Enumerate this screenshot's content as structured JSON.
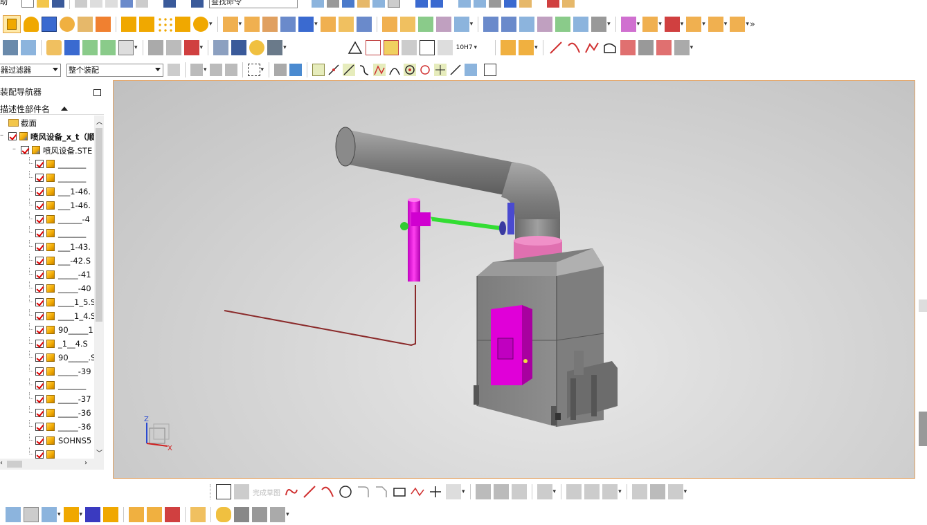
{
  "window": {
    "title_partial": "助"
  },
  "toolbar_top": {
    "command_finder_placeholder": "查找命令"
  },
  "selection_bar": {
    "filter_select": "器过滤器",
    "scope_select": "整个装配"
  },
  "navigator": {
    "title": "装配导航器",
    "column_header": "描述性部件名",
    "items": [
      {
        "label": "截面",
        "type": "folder",
        "indent": 0
      },
      {
        "label": "喷风设备_x_t（顺",
        "type": "assembly",
        "indent": 1,
        "bold": true
      },
      {
        "label": "喷风设备.STE",
        "type": "assembly",
        "indent": 2
      },
      {
        "label": "_______",
        "type": "part"
      },
      {
        "label": "_______",
        "type": "part"
      },
      {
        "label": "___1-46.",
        "type": "part"
      },
      {
        "label": "___1-46.",
        "type": "part"
      },
      {
        "label": "______-4",
        "type": "part"
      },
      {
        "label": "_______",
        "type": "part"
      },
      {
        "label": "___1-43.",
        "type": "part"
      },
      {
        "label": "___-42.S",
        "type": "part"
      },
      {
        "label": "_____-41",
        "type": "part"
      },
      {
        "label": "_____-40",
        "type": "part"
      },
      {
        "label": "____1_5.S",
        "type": "part"
      },
      {
        "label": "____1_4.S",
        "type": "part"
      },
      {
        "label": "90_____1",
        "type": "part"
      },
      {
        "label": "_1__4.S",
        "type": "part"
      },
      {
        "label": "90_____.S",
        "type": "part"
      },
      {
        "label": "_____-39",
        "type": "part"
      },
      {
        "label": "_______",
        "type": "part"
      },
      {
        "label": "_____-37",
        "type": "part"
      },
      {
        "label": "_____-36",
        "type": "part"
      },
      {
        "label": "_____-36",
        "type": "part"
      },
      {
        "label": "SOHNS5",
        "type": "part"
      },
      {
        "label": "",
        "type": "part"
      }
    ]
  },
  "viewport": {
    "triad": {
      "z_label": "Z",
      "x_label": "X"
    }
  },
  "toolbar_mid": {
    "tol_label": "10H7"
  },
  "bottom_toolbar": {
    "finish_sketch_label": "完成草图"
  },
  "colors": {
    "model_gray": "#8c8c8c",
    "magenta": "#e000d8",
    "green_pipe": "#33dd33",
    "pink_ring": "#e070b0",
    "viewport_border": "#e0a060"
  }
}
